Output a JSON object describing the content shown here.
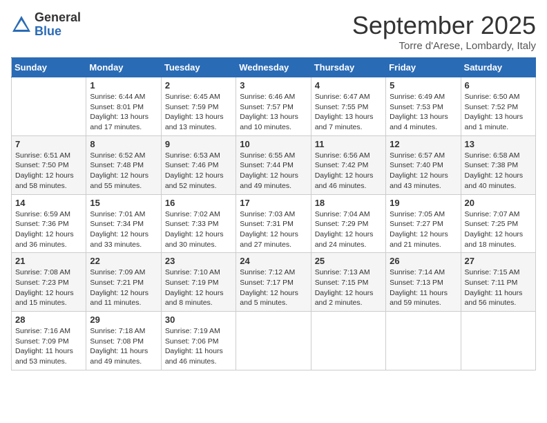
{
  "logo": {
    "general": "General",
    "blue": "Blue"
  },
  "title": "September 2025",
  "subtitle": "Torre d'Arese, Lombardy, Italy",
  "headers": [
    "Sunday",
    "Monday",
    "Tuesday",
    "Wednesday",
    "Thursday",
    "Friday",
    "Saturday"
  ],
  "weeks": [
    [
      {
        "day": "",
        "info": ""
      },
      {
        "day": "1",
        "info": "Sunrise: 6:44 AM\nSunset: 8:01 PM\nDaylight: 13 hours\nand 17 minutes."
      },
      {
        "day": "2",
        "info": "Sunrise: 6:45 AM\nSunset: 7:59 PM\nDaylight: 13 hours\nand 13 minutes."
      },
      {
        "day": "3",
        "info": "Sunrise: 6:46 AM\nSunset: 7:57 PM\nDaylight: 13 hours\nand 10 minutes."
      },
      {
        "day": "4",
        "info": "Sunrise: 6:47 AM\nSunset: 7:55 PM\nDaylight: 13 hours\nand 7 minutes."
      },
      {
        "day": "5",
        "info": "Sunrise: 6:49 AM\nSunset: 7:53 PM\nDaylight: 13 hours\nand 4 minutes."
      },
      {
        "day": "6",
        "info": "Sunrise: 6:50 AM\nSunset: 7:52 PM\nDaylight: 13 hours\nand 1 minute."
      }
    ],
    [
      {
        "day": "7",
        "info": "Sunrise: 6:51 AM\nSunset: 7:50 PM\nDaylight: 12 hours\nand 58 minutes."
      },
      {
        "day": "8",
        "info": "Sunrise: 6:52 AM\nSunset: 7:48 PM\nDaylight: 12 hours\nand 55 minutes."
      },
      {
        "day": "9",
        "info": "Sunrise: 6:53 AM\nSunset: 7:46 PM\nDaylight: 12 hours\nand 52 minutes."
      },
      {
        "day": "10",
        "info": "Sunrise: 6:55 AM\nSunset: 7:44 PM\nDaylight: 12 hours\nand 49 minutes."
      },
      {
        "day": "11",
        "info": "Sunrise: 6:56 AM\nSunset: 7:42 PM\nDaylight: 12 hours\nand 46 minutes."
      },
      {
        "day": "12",
        "info": "Sunrise: 6:57 AM\nSunset: 7:40 PM\nDaylight: 12 hours\nand 43 minutes."
      },
      {
        "day": "13",
        "info": "Sunrise: 6:58 AM\nSunset: 7:38 PM\nDaylight: 12 hours\nand 40 minutes."
      }
    ],
    [
      {
        "day": "14",
        "info": "Sunrise: 6:59 AM\nSunset: 7:36 PM\nDaylight: 12 hours\nand 36 minutes."
      },
      {
        "day": "15",
        "info": "Sunrise: 7:01 AM\nSunset: 7:34 PM\nDaylight: 12 hours\nand 33 minutes."
      },
      {
        "day": "16",
        "info": "Sunrise: 7:02 AM\nSunset: 7:33 PM\nDaylight: 12 hours\nand 30 minutes."
      },
      {
        "day": "17",
        "info": "Sunrise: 7:03 AM\nSunset: 7:31 PM\nDaylight: 12 hours\nand 27 minutes."
      },
      {
        "day": "18",
        "info": "Sunrise: 7:04 AM\nSunset: 7:29 PM\nDaylight: 12 hours\nand 24 minutes."
      },
      {
        "day": "19",
        "info": "Sunrise: 7:05 AM\nSunset: 7:27 PM\nDaylight: 12 hours\nand 21 minutes."
      },
      {
        "day": "20",
        "info": "Sunrise: 7:07 AM\nSunset: 7:25 PM\nDaylight: 12 hours\nand 18 minutes."
      }
    ],
    [
      {
        "day": "21",
        "info": "Sunrise: 7:08 AM\nSunset: 7:23 PM\nDaylight: 12 hours\nand 15 minutes."
      },
      {
        "day": "22",
        "info": "Sunrise: 7:09 AM\nSunset: 7:21 PM\nDaylight: 12 hours\nand 11 minutes."
      },
      {
        "day": "23",
        "info": "Sunrise: 7:10 AM\nSunset: 7:19 PM\nDaylight: 12 hours\nand 8 minutes."
      },
      {
        "day": "24",
        "info": "Sunrise: 7:12 AM\nSunset: 7:17 PM\nDaylight: 12 hours\nand 5 minutes."
      },
      {
        "day": "25",
        "info": "Sunrise: 7:13 AM\nSunset: 7:15 PM\nDaylight: 12 hours\nand 2 minutes."
      },
      {
        "day": "26",
        "info": "Sunrise: 7:14 AM\nSunset: 7:13 PM\nDaylight: 11 hours\nand 59 minutes."
      },
      {
        "day": "27",
        "info": "Sunrise: 7:15 AM\nSunset: 7:11 PM\nDaylight: 11 hours\nand 56 minutes."
      }
    ],
    [
      {
        "day": "28",
        "info": "Sunrise: 7:16 AM\nSunset: 7:09 PM\nDaylight: 11 hours\nand 53 minutes."
      },
      {
        "day": "29",
        "info": "Sunrise: 7:18 AM\nSunset: 7:08 PM\nDaylight: 11 hours\nand 49 minutes."
      },
      {
        "day": "30",
        "info": "Sunrise: 7:19 AM\nSunset: 7:06 PM\nDaylight: 11 hours\nand 46 minutes."
      },
      {
        "day": "",
        "info": ""
      },
      {
        "day": "",
        "info": ""
      },
      {
        "day": "",
        "info": ""
      },
      {
        "day": "",
        "info": ""
      }
    ]
  ]
}
